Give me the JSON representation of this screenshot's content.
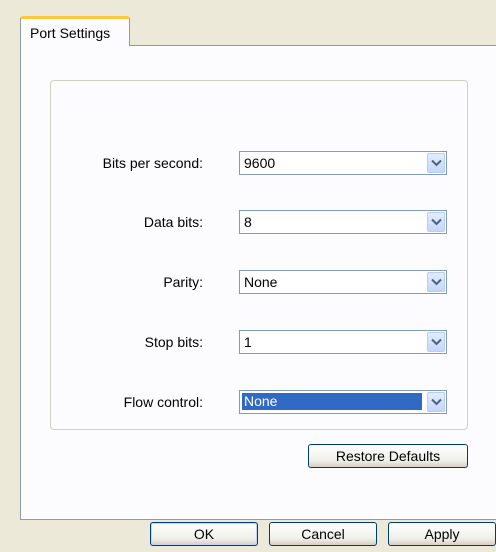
{
  "tabs": [
    {
      "label": "Port Settings"
    }
  ],
  "fields": {
    "bits_per_second": {
      "label": "Bits per second:",
      "value": "9600"
    },
    "data_bits": {
      "label": "Data bits:",
      "value": "8"
    },
    "parity": {
      "label": "Parity:",
      "value": "None"
    },
    "stop_bits": {
      "label": "Stop bits:",
      "value": "1"
    },
    "flow_control": {
      "label": "Flow control:",
      "value": "None"
    }
  },
  "restore_defaults_label": "Restore Defaults",
  "dialog_buttons": {
    "ok": "OK",
    "cancel": "Cancel",
    "apply": "Apply"
  },
  "colors": {
    "dialog_background": "#ECE9D8",
    "tab_accent": "#FFC83C",
    "selection": "#316AC5",
    "combo_border": "#7F9DB9",
    "button_border": "#003C74"
  }
}
